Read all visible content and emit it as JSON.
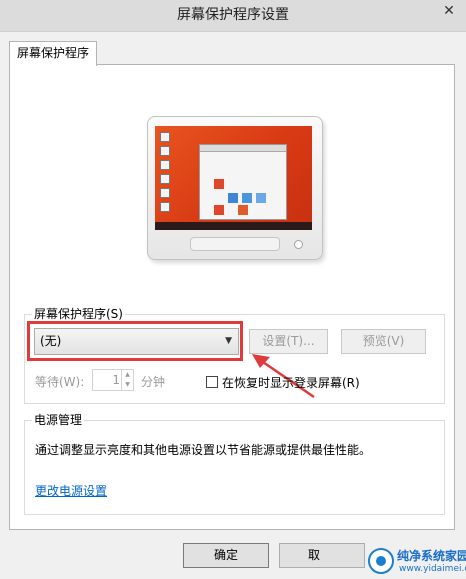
{
  "window": {
    "title": "屏幕保护程序设置",
    "close_glyph": "✕"
  },
  "tabs": [
    {
      "label": "屏幕保护程序"
    }
  ],
  "screensaver": {
    "group_label": "屏幕保护程序(S)",
    "selected": "(无)",
    "settings_button": "设置(T)...",
    "preview_button": "预览(V)",
    "wait_label": "等待(W):",
    "wait_value": "1",
    "wait_unit": "分钟",
    "resume_checkbox_label": "在恢复时显示登录屏幕(R)",
    "resume_checked": false
  },
  "power": {
    "group_label": "电源管理",
    "description": "通过调整显示亮度和其他电源设置以节省能源或提供最佳性能。",
    "link": "更改电源设置"
  },
  "footer": {
    "ok_button": "确定",
    "cancel_button_partial": "取"
  },
  "watermark": {
    "title": "纯净系统家园",
    "url": "www.yidaimei.com"
  },
  "colors": {
    "annotation": "#e03a3a",
    "link": "#0066cc",
    "screen_wallpaper": "#d83a14"
  }
}
